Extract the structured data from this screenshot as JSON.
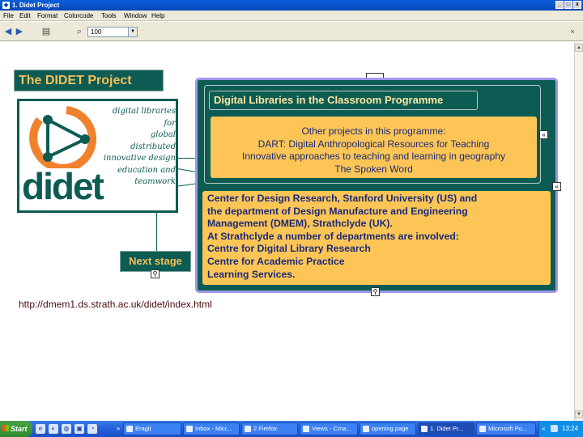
{
  "window": {
    "title": "1. Didet Project",
    "controls": {
      "minimize": "_",
      "maximize": "□",
      "close": "x"
    }
  },
  "menu": [
    "File",
    "Edit",
    "Format",
    "Colorcode",
    "Tools",
    "Window",
    "Help"
  ],
  "toolbar": {
    "zoom_value": "100"
  },
  "diagram": {
    "project_title": "The DIDET Project",
    "logo_tagline": [
      "digital libraries for",
      "global distributed",
      "innovative design",
      "education and",
      "teamwork"
    ],
    "logo_word": "didet",
    "next_stage": "Next stage",
    "programme_title": "Digital Libraries in the Classroom Programme",
    "other_projects": {
      "heading": "Other projects in this programme:",
      "items": [
        "DART: Digital Anthropological Resources for Teaching",
        "Innovative approaches to teaching and learning in geography",
        "The Spoken Word"
      ]
    },
    "partners": [
      "Center for Design Research, Stanford University (US) and",
      "the department of Design Manufacture and Engineering",
      "Management (DMEM), Strathclyde (UK).",
      "At Strathclyde a number of departments are involved:",
      "Centre for Digital Library Research",
      "Centre for Academic Practice",
      "Learning Services."
    ],
    "url": "http://dmem1.ds.strath.ac.uk/didet/index.html"
  },
  "taskbar": {
    "start": "Start",
    "tasks": [
      {
        "label": "Eragit"
      },
      {
        "label": "Inbox - Micr..."
      },
      {
        "label": "2 Firefox"
      },
      {
        "label": "Views - Cma..."
      },
      {
        "label": "opening page"
      },
      {
        "label": "1. Didet Pr..."
      },
      {
        "label": "Microsoft Po..."
      }
    ],
    "clock": "13:24"
  },
  "colors": {
    "teal": "#0d5c54",
    "orange_box": "#fcc556",
    "title_text": "#f3bf58",
    "frame_border": "#9d98e6"
  }
}
